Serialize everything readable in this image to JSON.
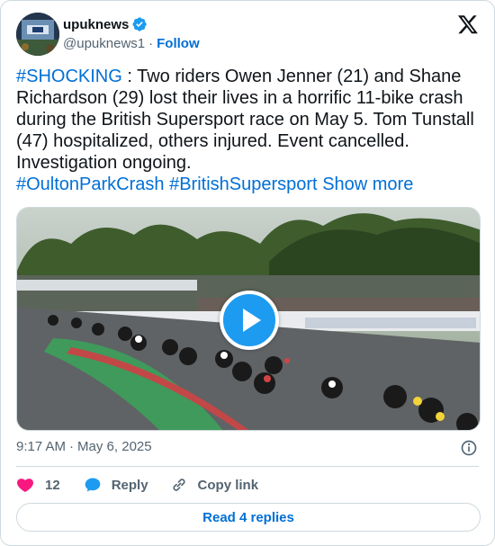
{
  "author": {
    "name": "upuknews",
    "handle": "@upuknews1",
    "follow_label": "Follow",
    "verified": true
  },
  "tweet": {
    "segments": [
      {
        "type": "tag",
        "text": "#SHOCKING"
      },
      {
        "type": "text",
        "text": " : Two riders Owen Jenner (21) and Shane Richardson (29) lost their lives in a horrific 11-bike crash during the British Supersport race on May 5. Tom Tunstall (47) hospitalized, others injured. Event cancelled. Investigation ongoing."
      },
      {
        "type": "tag",
        "text": "#OultonParkCrash"
      },
      {
        "type": "tag",
        "text": "#BritishSupersport"
      }
    ],
    "show_more": "Show more"
  },
  "meta": {
    "time": "9:17 AM",
    "date": "May 6, 2025"
  },
  "actions": {
    "likes": "12",
    "reply_label": "Reply",
    "copy_label": "Copy link",
    "read_replies": "Read 4 replies"
  },
  "colors": {
    "accent": "#1d9bf0",
    "link": "#006fd6",
    "like": "#f91880",
    "secondary": "#536471"
  },
  "icons": {
    "verified": "verified-badge-icon",
    "x": "x-logo-icon",
    "play": "play-icon",
    "info": "info-icon",
    "like": "heart-icon",
    "reply": "reply-bubble-icon",
    "copy": "link-icon"
  }
}
